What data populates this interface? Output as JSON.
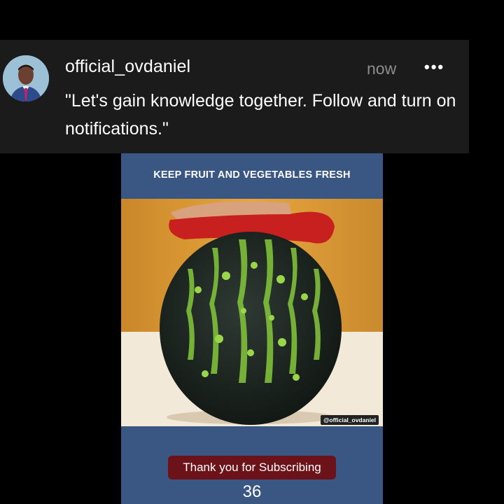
{
  "post": {
    "username": "official_ovdaniel",
    "time": "now",
    "more_icon": "•••",
    "message": "\"Let's gain knowledge together. Follow and turn on notifications.\""
  },
  "video": {
    "title": "KEEP FRUIT AND VEGETABLES FRESH",
    "watermark": "@official_ovdaniel",
    "subscribe_label": "Thank you for Subscribing",
    "count": "36"
  },
  "colors": {
    "notification_bg": "#1b1b1b",
    "video_frame_bg": "#3a5783",
    "subscribe_bg": "#6b1319",
    "time_text": "#8d8d8d"
  }
}
